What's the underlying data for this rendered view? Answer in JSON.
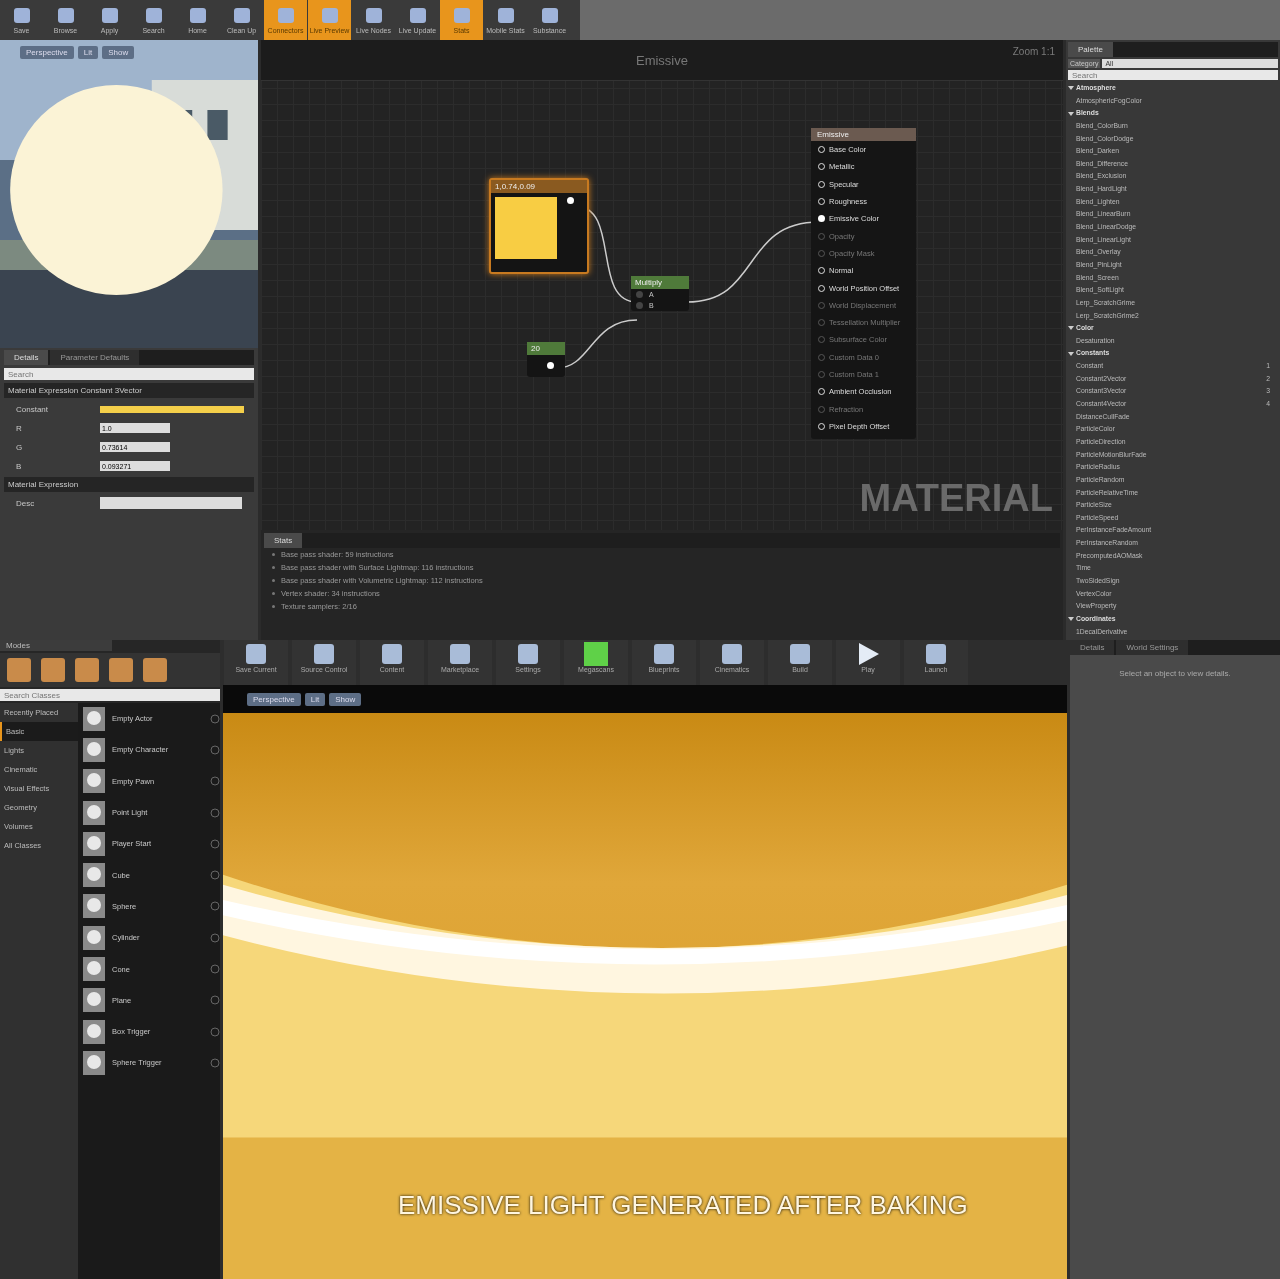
{
  "material_toolbar": [
    {
      "label": "Save",
      "active": false
    },
    {
      "label": "Browse",
      "active": false
    },
    {
      "label": "Apply",
      "active": false
    },
    {
      "label": "Search",
      "active": false
    },
    {
      "label": "Home",
      "active": false
    },
    {
      "label": "Clean Up",
      "active": false
    },
    {
      "label": "Connectors",
      "active": true
    },
    {
      "label": "Live Preview",
      "active": true
    },
    {
      "label": "Live Nodes",
      "active": false
    },
    {
      "label": "Live Update",
      "active": false
    },
    {
      "label": "Stats",
      "active": true
    },
    {
      "label": "Mobile Stats",
      "active": false
    },
    {
      "label": "Substance",
      "active": false
    }
  ],
  "preview_viewport": {
    "buttons": [
      "Perspective",
      "Lit",
      "Show"
    ]
  },
  "details": {
    "tabs": [
      {
        "label": "Details",
        "selected": true
      },
      {
        "label": "Parameter Defaults",
        "selected": false
      }
    ],
    "search": {
      "placeholder": "Search"
    },
    "sections": [
      {
        "title": "Material Expression Constant 3Vector",
        "rows": [
          {
            "kind": "color",
            "label": "Constant"
          },
          {
            "kind": "number",
            "label": "R",
            "value": "1.0"
          },
          {
            "kind": "number",
            "label": "G",
            "value": "0.73614"
          },
          {
            "kind": "number",
            "label": "B",
            "value": "0.093271"
          }
        ]
      },
      {
        "title": "Material Expression",
        "rows": [
          {
            "kind": "text",
            "label": "Desc",
            "value": ""
          }
        ]
      }
    ]
  },
  "graph": {
    "title": "Emissive",
    "zoom": "Zoom 1:1",
    "watermark": "MATERIAL",
    "color_node": {
      "title": "1,0.74,0.09"
    },
    "multiply_node": {
      "title": "Multiply",
      "inputs": [
        "A",
        "B"
      ]
    },
    "constant_node": {
      "title": "20"
    },
    "result_node": {
      "title": "Emissive",
      "pins": [
        {
          "label": "Base Color",
          "enabled": true,
          "connected": false
        },
        {
          "label": "Metallic",
          "enabled": true,
          "connected": false
        },
        {
          "label": "Specular",
          "enabled": true,
          "connected": false
        },
        {
          "label": "Roughness",
          "enabled": true,
          "connected": false
        },
        {
          "label": "Emissive Color",
          "enabled": true,
          "connected": true
        },
        {
          "label": "Opacity",
          "enabled": false,
          "connected": false
        },
        {
          "label": "Opacity Mask",
          "enabled": false,
          "connected": false
        },
        {
          "label": "Normal",
          "enabled": true,
          "connected": false
        },
        {
          "label": "World Position Offset",
          "enabled": true,
          "connected": false
        },
        {
          "label": "World Displacement",
          "enabled": false,
          "connected": false
        },
        {
          "label": "Tessellation Multiplier",
          "enabled": false,
          "connected": false
        },
        {
          "label": "Subsurface Color",
          "enabled": false,
          "connected": false
        },
        {
          "label": "Custom Data 0",
          "enabled": false,
          "connected": false
        },
        {
          "label": "Custom Data 1",
          "enabled": false,
          "connected": false
        },
        {
          "label": "Ambient Occlusion",
          "enabled": true,
          "connected": false
        },
        {
          "label": "Refraction",
          "enabled": false,
          "connected": false
        },
        {
          "label": "Pixel Depth Offset",
          "enabled": true,
          "connected": false
        }
      ]
    }
  },
  "stats": {
    "tab": "Stats",
    "lines": [
      "Base pass shader: 59 instructions",
      "Base pass shader with Surface Lightmap: 116 instructions",
      "Base pass shader with Volumetric Lightmap: 112 instructions",
      "Vertex shader: 34 instructions",
      "Texture samplers: 2/16"
    ]
  },
  "palette": {
    "tab": "Palette",
    "category_label": "Category",
    "category": "All",
    "search": {
      "placeholder": "Search"
    },
    "groups": [
      {
        "label": "Atmosphere",
        "expanded": true,
        "children": [
          {
            "label": "AtmosphericFogColor"
          }
        ]
      },
      {
        "label": "Blends",
        "expanded": true,
        "children": [
          {
            "label": "Blend_ColorBurn"
          },
          {
            "label": "Blend_ColorDodge"
          },
          {
            "label": "Blend_Darken"
          },
          {
            "label": "Blend_Difference"
          },
          {
            "label": "Blend_Exclusion"
          },
          {
            "label": "Blend_HardLight"
          },
          {
            "label": "Blend_Lighten"
          },
          {
            "label": "Blend_LinearBurn"
          },
          {
            "label": "Blend_LinearDodge"
          },
          {
            "label": "Blend_LinearLight"
          },
          {
            "label": "Blend_Overlay"
          },
          {
            "label": "Blend_PinLight"
          },
          {
            "label": "Blend_Screen"
          },
          {
            "label": "Blend_SoftLight"
          },
          {
            "label": "Lerp_ScratchGrime"
          },
          {
            "label": "Lerp_ScratchGrime2"
          }
        ]
      },
      {
        "label": "Color",
        "expanded": true,
        "children": [
          {
            "label": "Desaturation"
          }
        ]
      },
      {
        "label": "Constants",
        "expanded": true,
        "children": [
          {
            "label": "Constant",
            "hotkey": "1"
          },
          {
            "label": "Constant2Vector",
            "hotkey": "2"
          },
          {
            "label": "Constant3Vector",
            "hotkey": "3"
          },
          {
            "label": "Constant4Vector",
            "hotkey": "4"
          },
          {
            "label": "DistanceCullFade"
          },
          {
            "label": "ParticleColor"
          },
          {
            "label": "ParticleDirection"
          },
          {
            "label": "ParticleMotionBlurFade"
          },
          {
            "label": "ParticleRadius"
          },
          {
            "label": "ParticleRandom"
          },
          {
            "label": "ParticleRelativeTime"
          },
          {
            "label": "ParticleSize"
          },
          {
            "label": "ParticleSpeed"
          },
          {
            "label": "PerInstanceFadeAmount"
          },
          {
            "label": "PerInstanceRandom"
          },
          {
            "label": "PrecomputedAOMask"
          },
          {
            "label": "Time"
          },
          {
            "label": "TwoSidedSign"
          },
          {
            "label": "VertexColor"
          },
          {
            "label": "ViewProperty"
          }
        ]
      },
      {
        "label": "Coordinates",
        "expanded": true,
        "children": [
          {
            "label": "1DecalDerivative"
          }
        ]
      }
    ]
  },
  "modes": {
    "title": "Modes",
    "search": {
      "placeholder": "Search Classes"
    },
    "categories": [
      {
        "label": "Recently Placed",
        "selected": false
      },
      {
        "label": "Basic",
        "selected": true
      },
      {
        "label": "Lights",
        "selected": false
      },
      {
        "label": "Cinematic",
        "selected": false
      },
      {
        "label": "Visual Effects",
        "selected": false
      },
      {
        "label": "Geometry",
        "selected": false
      },
      {
        "label": "Volumes",
        "selected": false
      },
      {
        "label": "All Classes",
        "selected": false
      }
    ],
    "items": [
      "Empty Actor",
      "Empty Character",
      "Empty Pawn",
      "Point Light",
      "Player Start",
      "Cube",
      "Sphere",
      "Cylinder",
      "Cone",
      "Plane",
      "Box Trigger",
      "Sphere Trigger"
    ]
  },
  "level_toolbar": [
    {
      "label": "Save Current",
      "kind": "tile"
    },
    {
      "label": "Source Control",
      "kind": "tile"
    },
    {
      "label": "Content",
      "kind": "tile"
    },
    {
      "label": "Marketplace",
      "kind": "tile"
    },
    {
      "label": "Settings",
      "kind": "tile"
    },
    {
      "label": "Megascans",
      "kind": "green"
    },
    {
      "label": "Blueprints",
      "kind": "tile"
    },
    {
      "label": "Cinematics",
      "kind": "tile"
    },
    {
      "label": "Build",
      "kind": "tile"
    },
    {
      "label": "Play",
      "kind": "play"
    },
    {
      "label": "Launch",
      "kind": "tile"
    }
  ],
  "level_viewport": {
    "buttons": [
      "Perspective",
      "Lit",
      "Show"
    ],
    "caption": "EMISSIVE LIGHT GENERATED AFTER BAKING"
  },
  "details_panel": {
    "tabs": [
      "Details",
      "World Settings"
    ],
    "hint": "Select an object to view details."
  }
}
